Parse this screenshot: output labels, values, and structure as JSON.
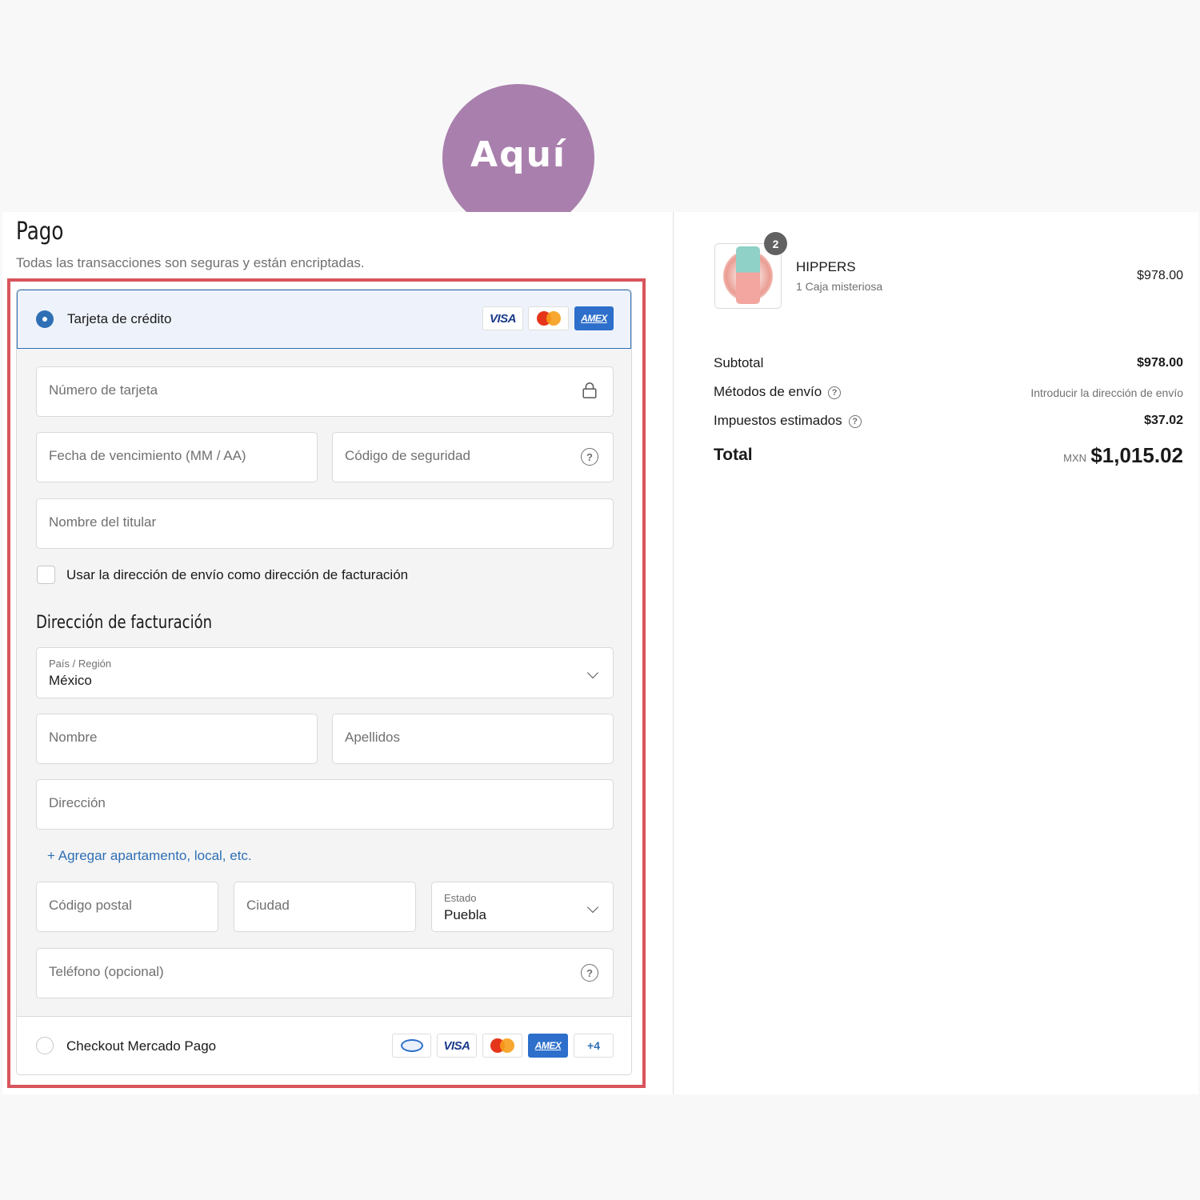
{
  "callout": {
    "text": "Aquí",
    "color": "#a980ad"
  },
  "payment": {
    "title": "Pago",
    "subtitle": "Todas las transacciones son seguras y están encriptadas.",
    "credit_card": {
      "label": "Tarjeta de crédito",
      "selected": true,
      "brands": [
        "VISA",
        "mastercard",
        "AMEX"
      ],
      "fields": {
        "card_number": "Número de tarjeta",
        "expiry": "Fecha de vencimiento (MM / AA)",
        "security_code": "Código de seguridad",
        "holder_name": "Nombre del titular"
      },
      "use_shipping_label": "Usar la dirección de envío como dirección de facturación",
      "use_shipping_checked": false
    },
    "billing": {
      "title": "Dirección de facturación",
      "country_label": "País / Región",
      "country_value": "México",
      "first_name": "Nombre",
      "last_name": "Apellidos",
      "address": "Dirección",
      "add_apartment": "Agregar apartamento, local, etc.",
      "postal_code": "Código postal",
      "city": "Ciudad",
      "state_label": "Estado",
      "state_value": "Puebla",
      "phone": "Teléfono (opcional)"
    },
    "mercado_pago": {
      "label": "Checkout Mercado Pago",
      "selected": false,
      "brands": [
        "mercado-pago",
        "VISA",
        "mastercard",
        "AMEX",
        "+4"
      ],
      "more": "+4"
    }
  },
  "order": {
    "product": {
      "name": "HIPPERS",
      "variant": "1 Caja misteriosa",
      "price": "$978.00",
      "quantity": "2"
    },
    "subtotal_label": "Subtotal",
    "subtotal_value": "$978.00",
    "shipping_label": "Métodos de envío",
    "shipping_value": "Introducir la dirección de envío",
    "taxes_label": "Impuestos estimados",
    "taxes_value": "$37.02",
    "total_label": "Total",
    "total_currency": "MXN",
    "total_value": "$1,015.02"
  },
  "colors": {
    "accent": "#2f6fb5",
    "highlight_border": "#d9545c"
  },
  "icons": [
    "lock-icon",
    "help-icon",
    "chevron-down-icon",
    "plus-icon"
  ]
}
